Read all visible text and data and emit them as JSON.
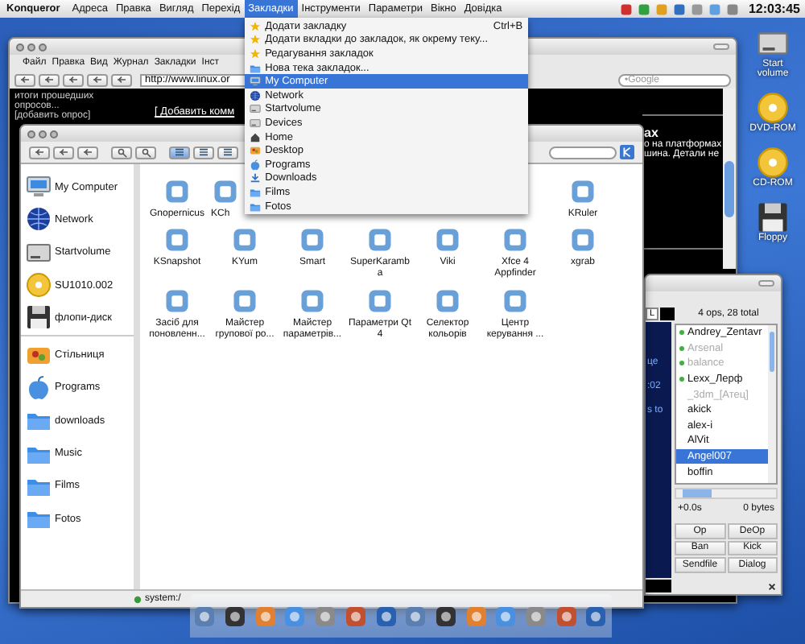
{
  "menubar": {
    "app": "Konqueror",
    "items": [
      {
        "label": "Адреса",
        "selected": false
      },
      {
        "label": "Правка",
        "selected": false
      },
      {
        "label": "Вигляд",
        "selected": false
      },
      {
        "label": "Перехід",
        "selected": false
      },
      {
        "label": "Закладки",
        "selected": true
      },
      {
        "label": "Інструменти",
        "selected": false
      },
      {
        "label": "Параметри",
        "selected": false
      },
      {
        "label": "Вікно",
        "selected": false
      },
      {
        "label": "Довідка",
        "selected": false
      }
    ],
    "clock": "12:03:45"
  },
  "bookmarks_menu": {
    "items": [
      {
        "label": "Додати закладку",
        "shortcut": "Ctrl+B",
        "kind": "star",
        "selected": false
      },
      {
        "label": "Додати вкладки до закладок, як окрему теку...",
        "kind": "star",
        "selected": false
      },
      {
        "label": "Редагування закладок",
        "kind": "star",
        "selected": false
      },
      {
        "label": "Нова тека закладок...",
        "kind": "folder",
        "selected": false
      },
      {
        "label": "My Computer",
        "kind": "computer",
        "selected": true
      },
      {
        "label": "Network",
        "kind": "globe",
        "selected": false
      },
      {
        "label": "Startvolume",
        "kind": "drive",
        "selected": false
      },
      {
        "label": "Devices",
        "kind": "drive",
        "selected": false
      },
      {
        "label": "Home",
        "kind": "home",
        "selected": false
      },
      {
        "label": "Desktop",
        "kind": "desktop",
        "selected": false
      },
      {
        "label": "Programs",
        "kind": "apple",
        "selected": false
      },
      {
        "label": "Downloads",
        "kind": "download",
        "selected": false
      },
      {
        "label": "Films",
        "kind": "folder",
        "selected": false
      },
      {
        "label": "Fotos",
        "kind": "folder",
        "selected": false
      }
    ]
  },
  "desktop_icons": [
    {
      "label": "Start volume",
      "kind": "drive"
    },
    {
      "label": "DVD-ROM",
      "kind": "disc"
    },
    {
      "label": "CD-ROM",
      "kind": "disc"
    },
    {
      "label": "Floppy",
      "kind": "floppy"
    }
  ],
  "browser": {
    "menu": [
      "Файл",
      "Правка",
      "Вид",
      "Журнал",
      "Закладки",
      "Інст"
    ],
    "url": "http://www.linux.or",
    "search_placeholder": "•Google",
    "poll_lines": [
      "итоги прошедших",
      "опросов...",
      "[добавить опрос]"
    ],
    "comment_link": "[ Добавить комм",
    "heading": "ах",
    "text_lines": [
      "о на платформах",
      "шина. Детали не"
    ]
  },
  "file_manager": {
    "places": [
      {
        "label": "My Computer",
        "kind": "computer"
      },
      {
        "label": "Network",
        "kind": "globe"
      },
      {
        "label": "Startvolume",
        "kind": "drive"
      },
      {
        "label": "SU1010.002",
        "kind": "disc"
      },
      {
        "label": "флопи-диск",
        "kind": "floppy"
      }
    ],
    "bookmarks": [
      {
        "label": "Стільниця",
        "kind": "desktop"
      },
      {
        "label": "Programs",
        "kind": "apple"
      },
      {
        "label": "downloads",
        "kind": "folder"
      },
      {
        "label": "Music",
        "kind": "folder"
      },
      {
        "label": "Films",
        "kind": "folder"
      },
      {
        "label": "Fotos",
        "kind": "folder"
      }
    ],
    "icon_rows": [
      {
        "items": [
          {
            "label": "Gnopernicus",
            "cut": false
          },
          {
            "label": "KCh",
            "cut": true
          }
        ],
        "end_items": [
          {
            "label": "KRuler",
            "cut": false
          }
        ]
      },
      {
        "items": [
          {
            "label": "KSnapshot",
            "cut": false
          },
          {
            "label": "KYum",
            "cut": false
          },
          {
            "label": "Smart",
            "cut": false
          },
          {
            "label": "SuperKaramba",
            "cut": false
          },
          {
            "label": "Viki",
            "cut": false
          },
          {
            "label": "Xfce 4 Appfinder",
            "cut": false
          },
          {
            "label": "xgrab",
            "cut": false
          }
        ]
      },
      {
        "items": [
          {
            "label": "Засіб для поновленн...",
            "cut": false
          },
          {
            "label": "Майстер групової ро...",
            "cut": false
          },
          {
            "label": "Майстер параметрів...",
            "cut": false
          },
          {
            "label": "Параметри Qt 4",
            "cut": false
          },
          {
            "label": "Селектор кольорів",
            "cut": false
          },
          {
            "label": "Центр керування ...",
            "cut": false
          }
        ]
      }
    ],
    "status": "system:/"
  },
  "chat": {
    "header_button": "L",
    "summary": "4 ops, 28 total",
    "log_fragments": [
      "це",
      ":02",
      "s to"
    ],
    "nicks": [
      {
        "name": "Andrey_Zentavr",
        "op": true,
        "away": false,
        "selected": false
      },
      {
        "name": "Arsenal",
        "op": true,
        "away": true,
        "selected": false
      },
      {
        "name": "balance",
        "op": true,
        "away": true,
        "selected": false
      },
      {
        "name": "Lexx_Лерф",
        "op": true,
        "away": false,
        "selected": false
      },
      {
        "name": "_3dm_[Атец]",
        "op": false,
        "away": true,
        "selected": false
      },
      {
        "name": "akick",
        "op": false,
        "away": false,
        "selected": false
      },
      {
        "name": "alex-i",
        "op": false,
        "away": false,
        "selected": false
      },
      {
        "name": "AlVit",
        "op": false,
        "away": false,
        "selected": false
      },
      {
        "name": "Angel007",
        "op": false,
        "away": false,
        "selected": true
      },
      {
        "name": "boffin",
        "op": false,
        "away": false,
        "selected": false
      }
    ],
    "lag": "+0.0s",
    "bytes": "0 bytes",
    "buttons": [
      "Op",
      "DeOp",
      "Ban",
      "Kick",
      "Sendfile",
      "Dialog"
    ]
  }
}
